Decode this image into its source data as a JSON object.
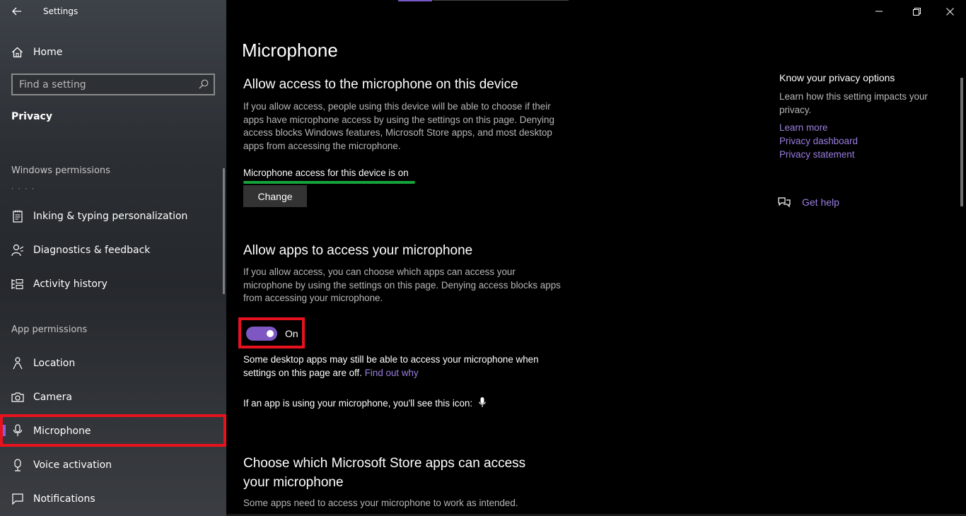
{
  "window": {
    "title": "Settings"
  },
  "sidebar": {
    "home_label": "Home",
    "search_placeholder": "Find a setting",
    "section": "Privacy",
    "groups": [
      {
        "title": "Windows permissions"
      },
      {
        "title": "App permissions"
      }
    ],
    "windows_items": [
      {
        "label": "Inking & typing personalization",
        "icon": "notepad-icon"
      },
      {
        "label": "Diagnostics & feedback",
        "icon": "person-feedback-icon"
      },
      {
        "label": "Activity history",
        "icon": "timeline-icon"
      }
    ],
    "app_items": [
      {
        "label": "Location",
        "icon": "location-person-icon"
      },
      {
        "label": "Camera",
        "icon": "camera-icon"
      },
      {
        "label": "Microphone",
        "icon": "microphone-icon",
        "active": true
      },
      {
        "label": "Voice activation",
        "icon": "voice-icon"
      },
      {
        "label": "Notifications",
        "icon": "notifications-icon"
      }
    ]
  },
  "main": {
    "page_title": "Microphone",
    "device_section": {
      "heading": "Allow access to the microphone on this device",
      "description": "If you allow access, people using this device will be able to choose if their apps have microphone access by using the settings on this page. Denying access blocks Windows features, Microsoft Store apps, and most desktop apps from accessing the microphone.",
      "status": "Microphone access for this device is on",
      "button": "Change"
    },
    "apps_section": {
      "heading": "Allow apps to access your microphone",
      "description": "If you allow access, you can choose which apps can access your microphone by using the settings on this page. Denying access blocks apps from accessing your microphone.",
      "toggle_label": "On",
      "toggle_on": true,
      "note": "Some desktop apps may still be able to access your microphone when settings on this page are off.",
      "note_link": "Find out why",
      "icon_note": "If an app is using your microphone, you'll see this icon:"
    },
    "store_section": {
      "heading_line1": "Choose which Microsoft Store apps can access",
      "heading_line2": "your microphone",
      "description": "Some apps need to access your microphone to work as intended."
    }
  },
  "right_panel": {
    "title": "Know your privacy options",
    "description": "Learn how this setting impacts your privacy.",
    "links": [
      "Learn more",
      "Privacy dashboard",
      "Privacy statement"
    ],
    "help": "Get help"
  },
  "colors": {
    "accent": "#7e57c2",
    "highlight": "#e8121f",
    "status_line": "#16a33a",
    "link": "#9b7ee0"
  }
}
